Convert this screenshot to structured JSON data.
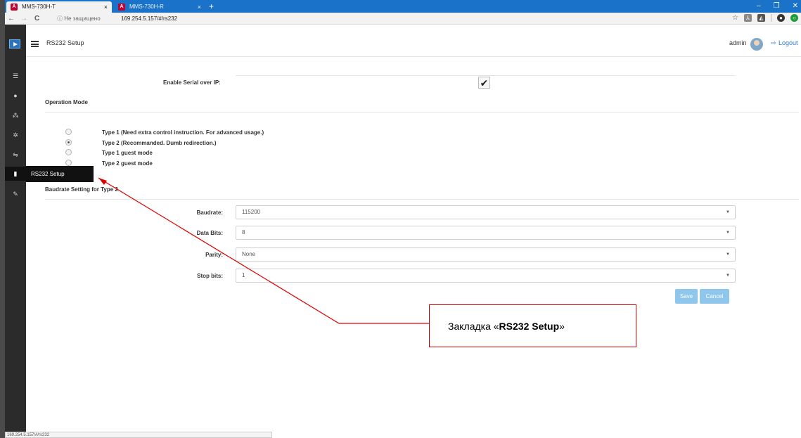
{
  "browser": {
    "tabs": [
      {
        "label": "MMS-730H-T",
        "close": "×"
      },
      {
        "label": "MMS-730H-R",
        "close": "×"
      }
    ],
    "new_tab": "+",
    "window_controls": [
      "–",
      "❐",
      "✕"
    ],
    "nav": {
      "back": "←",
      "forward": "→",
      "reload": "C"
    },
    "security_label": "ⓘ Не защищено",
    "url": "169.254.5.157/#/rs232"
  },
  "app": {
    "page_title": "RS232 Setup",
    "user": "admin",
    "logout_label": "Logout",
    "sidebar": {
      "icons": [
        "menu-icon",
        "user-icon",
        "network-icon",
        "gear-icon",
        "usb-icon",
        "serial-icon",
        "wrench-icon"
      ],
      "flyout_label": "RS232 Setup"
    }
  },
  "form": {
    "enable_serial_label": "Enable Serial over IP:",
    "enable_serial_checked": true,
    "operation_mode_heading": "Operation Mode",
    "modes": [
      {
        "label": "Type 1 (Need extra control instruction. For advanced usage.)",
        "checked": false
      },
      {
        "label": "Type 2 (Recommanded. Dumb redirection.)",
        "checked": true
      },
      {
        "label": "Type 1 guest mode",
        "checked": false
      },
      {
        "label": "Type 2 guest mode",
        "checked": false
      }
    ],
    "baudrate_heading": "Baudrate Setting for Type 2",
    "fields": {
      "baudrate": {
        "label": "Baudrate:",
        "value": "115200"
      },
      "data_bits": {
        "label": "Data Bits:",
        "value": "8"
      },
      "parity": {
        "label": "Parity:",
        "value": "None"
      },
      "stop_bits": {
        "label": "Stop bits:",
        "value": "1"
      }
    },
    "save_label": "Save",
    "cancel_label": "Cancel"
  },
  "annotation": {
    "prefix": "Закладка «",
    "bold": "RS232 Setup",
    "suffix": "»"
  },
  "status_bar_url": "169.254.5.157/#/rs232",
  "colors": {
    "accent": "#2a79c8",
    "sidebar": "#2b2b2b",
    "button": "#8fc6eb",
    "annotation": "#d00000"
  }
}
